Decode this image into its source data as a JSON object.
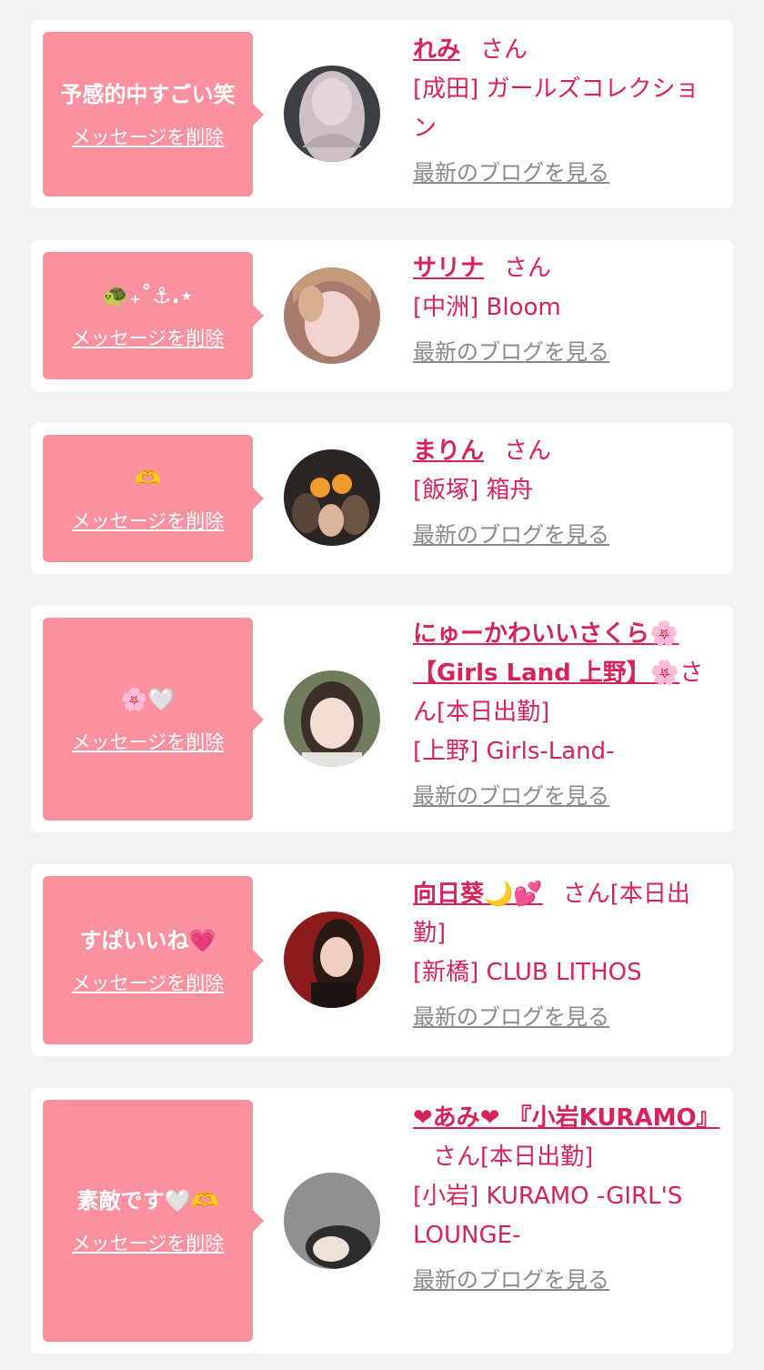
{
  "favorites": [
    {
      "message": "予感的中すごい笑",
      "delete_label": "メッセージを削除",
      "name": "れみ",
      "honorific": "さん",
      "shop": "[成田] ガールズコレクション",
      "blog_label": "最新のブログを見る"
    },
    {
      "message": "🐢₊˚⚓︎.⋆",
      "delete_label": "メッセージを削除",
      "name": "サリナ",
      "honorific": "さん",
      "shop": "[中洲] Bloom",
      "blog_label": "最新のブログを見る"
    },
    {
      "message": "🫶",
      "delete_label": "メッセージを削除",
      "name": "まりん",
      "honorific": "さん",
      "shop": "[飯塚] 箱舟",
      "blog_label": "最新のブログを見る"
    },
    {
      "message": "🌸🤍",
      "delete_label": "メッセージを削除",
      "name": "にゅーかわいいさくら🌸【Girls Land 上野】🌸",
      "honorific": "さん[本日出勤]",
      "shop": "[上野] Girls-Land-",
      "blog_label": "最新のブログを見る"
    },
    {
      "message": "すぱいいね💗",
      "delete_label": "メッセージを削除",
      "name": "向日葵🌙💕",
      "honorific": "さん[本日出勤]",
      "shop": "[新橋] CLUB LITHOS",
      "blog_label": "最新のブログを見る"
    },
    {
      "message": "素敵です🤍🫶",
      "delete_label": "メッセージを削除",
      "name": "❤あみ❤ 『小岩KURAMO』",
      "honorific": "さん[本日出勤]",
      "shop": "[小岩] KURAMO -GIRL'S LOUNGE-",
      "blog_label": "最新のブログを見る"
    }
  ],
  "colors": {
    "bubble": "#fb909f",
    "accent": "#d6245b",
    "link_gray": "#8a8a8a",
    "background": "#f2f2f2"
  }
}
